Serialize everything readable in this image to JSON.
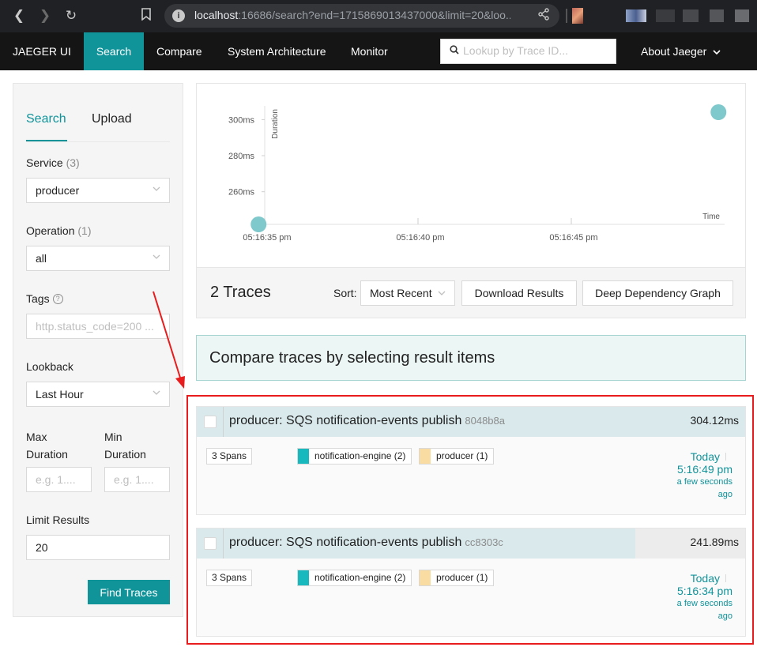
{
  "browser": {
    "url_host": "localhost",
    "url_rest": ":16686/search?end=1715869013437000&limit=20&loo...",
    "icons": [
      "back-arrow-icon",
      "forward-arrow-icon",
      "reload-icon",
      "bookmark-icon",
      "info-icon",
      "share-icon"
    ]
  },
  "nav": {
    "brand": "JAEGER UI",
    "items": [
      "Search",
      "Compare",
      "System Architecture",
      "Monitor"
    ],
    "active": "Search",
    "lookup_placeholder": "Lookup by Trace ID...",
    "about": "About Jaeger"
  },
  "sidebar": {
    "tabs": [
      "Search",
      "Upload"
    ],
    "service_label": "Service",
    "service_count": "(3)",
    "service_value": "producer",
    "operation_label": "Operation",
    "operation_count": "(1)",
    "operation_value": "all",
    "tags_label": "Tags",
    "tags_placeholder": "http.status_code=200 ...",
    "lookback_label": "Lookback",
    "lookback_value": "Last Hour",
    "max_label_1": "Max",
    "max_label_2": "Duration",
    "min_label_1": "Min",
    "min_label_2": "Duration",
    "max_placeholder": "e.g. 1....",
    "min_placeholder": "e.g. 1....",
    "limit_label": "Limit Results",
    "limit_value": "20",
    "find_button": "Find Traces"
  },
  "chart_data": {
    "type": "scatter",
    "ylabel": "Duration",
    "xlabel": "Time",
    "y_ticks": [
      "260ms",
      "280ms",
      "300ms"
    ],
    "x_ticks": [
      "05:16:35 pm",
      "05:16:40 pm",
      "05:16:45 pm"
    ],
    "y_tick_values": [
      260,
      280,
      300
    ],
    "x_tick_values": [
      35,
      40,
      45
    ],
    "xlim": [
      35,
      50
    ],
    "ylim": [
      241.89,
      304.12
    ],
    "points": [
      {
        "x": 34.8,
        "y": 241.89
      },
      {
        "x": 49.8,
        "y": 304.12
      }
    ],
    "point_color": "#7fc8cb"
  },
  "results": {
    "count_label": "2 Traces",
    "sort_label": "Sort:",
    "sort_value": "Most Recent",
    "download_button": "Download Results",
    "ddg_button": "Deep Dependency Graph"
  },
  "compare_banner": "Compare traces by selecting result items",
  "traces": [
    {
      "title": "producer: SQS notification-events publish",
      "id": "8048b8a",
      "duration": "304.12ms",
      "duration_fraction": 1.0,
      "spans": "3 Spans",
      "services": [
        {
          "name": "notification-engine (2)",
          "color": "#17b8be"
        },
        {
          "name": "producer (1)",
          "color": "#f8dcа1"
        }
      ],
      "day": "Today",
      "time": "5:16:49 pm",
      "ago_1": "a few seconds",
      "ago_2": "ago"
    },
    {
      "title": "producer: SQS notification-events publish",
      "id": "cc8303c",
      "duration": "241.89ms",
      "duration_fraction": 0.8,
      "spans": "3 Spans",
      "services": [
        {
          "name": "notification-engine (2)",
          "color": "#17b8be"
        },
        {
          "name": "producer (1)",
          "color": "#f8dca1"
        }
      ],
      "day": "Today",
      "time": "5:16:34 pm",
      "ago_1": "a few seconds",
      "ago_2": "ago"
    }
  ],
  "annotation_color": "#e81c1c"
}
